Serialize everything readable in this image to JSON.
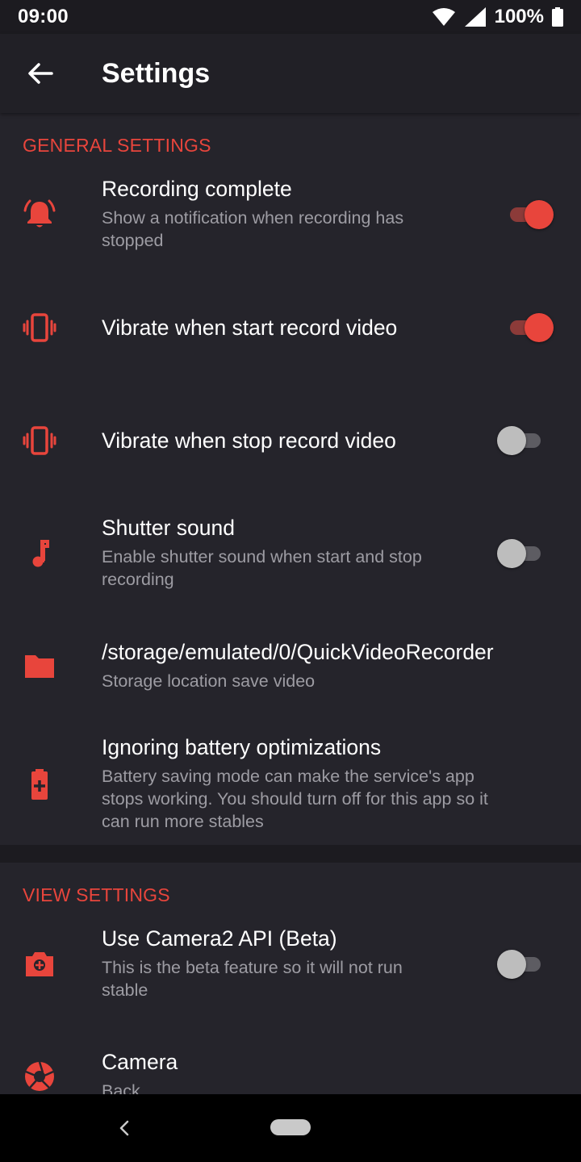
{
  "status_bar": {
    "time": "09:00",
    "battery": "100%"
  },
  "app_bar": {
    "title": "Settings"
  },
  "general": {
    "header": "GENERAL SETTINGS",
    "recording_complete": {
      "title": "Recording complete",
      "summary_line1": "Show a notification when recording has",
      "summary_line2": "stopped",
      "enabled": true
    },
    "vibrate_start": {
      "title": "Vibrate when start record video",
      "enabled": true
    },
    "vibrate_stop": {
      "title": "Vibrate when stop record video",
      "enabled": false
    },
    "shutter_sound": {
      "title": "Shutter sound",
      "summary_line1": "Enable shutter sound when start and stop",
      "summary_line2": "recording",
      "enabled": false
    },
    "storage": {
      "title": "/storage/emulated/0/QuickVideoRecorder",
      "summary": "Storage location save video"
    },
    "battery": {
      "title": "Ignoring battery optimizations",
      "summary_line1": "Battery saving mode can make the service's app",
      "summary_line2": "stops working. You should turn off for this app so it",
      "summary_line3": "can run more stables"
    }
  },
  "view": {
    "header": "VIEW SETTINGS",
    "camera2": {
      "title": "Use Camera2 API (Beta)",
      "summary_line1": "This is the beta feature so it will not run",
      "summary_line2": "stable",
      "enabled": false
    },
    "camera": {
      "title": "Camera",
      "summary": "Back"
    }
  },
  "colors": {
    "accent": "#e8453c",
    "background": "#25242b",
    "appbar": "#212026"
  }
}
